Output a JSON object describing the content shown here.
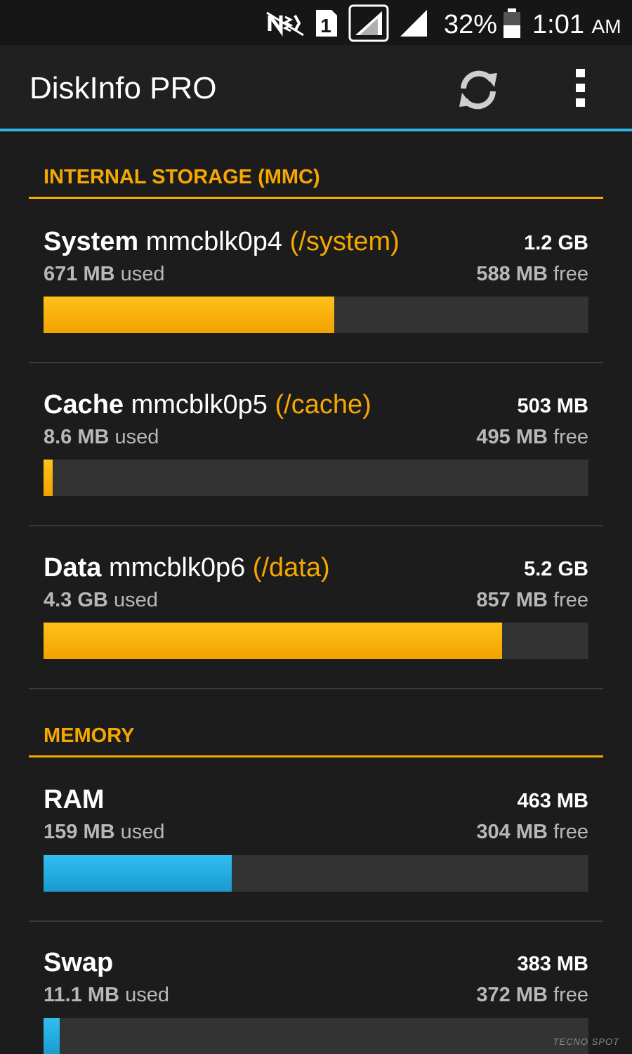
{
  "status_bar": {
    "battery_percent": "32%",
    "time": "1:01",
    "ampm": "AM",
    "sim_slot": "1",
    "icons": [
      "nfc-muted-icon",
      "sim-1-icon",
      "signal-boxed-icon",
      "signal-icon",
      "battery-icon"
    ]
  },
  "app_bar": {
    "title": "DiskInfo PRO",
    "refresh_icon": "refresh-icon",
    "menu_icon": "overflow-menu-icon"
  },
  "colors": {
    "accent": "#f5a800",
    "memory_bar": "#33b5e5",
    "action_bar_line": "#33b5e5",
    "background": "#1c1c1c"
  },
  "sections": [
    {
      "title": "INTERNAL STORAGE (MMC)",
      "items": [
        {
          "name": "System",
          "device": "mmcblk0p4",
          "mount": "(/system)",
          "total": "1.2 GB",
          "used_value": "671 MB",
          "used_label": "used",
          "free_value": "588 MB",
          "free_label": "free",
          "fill": 0.534,
          "color": "orange"
        },
        {
          "name": "Cache",
          "device": "mmcblk0p5",
          "mount": "(/cache)",
          "total": "503 MB",
          "used_value": "8.6 MB",
          "used_label": "used",
          "free_value": "495 MB",
          "free_label": "free",
          "fill": 0.017,
          "color": "orange"
        },
        {
          "name": "Data",
          "device": "mmcblk0p6",
          "mount": "(/data)",
          "total": "5.2 GB",
          "used_value": "4.3 GB",
          "used_label": "used",
          "free_value": "857 MB",
          "free_label": "free",
          "fill": 0.841,
          "color": "orange"
        }
      ]
    },
    {
      "title": "MEMORY",
      "items": [
        {
          "name": "RAM",
          "device": "",
          "mount": "",
          "total": "463 MB",
          "used_value": "159 MB",
          "used_label": "used",
          "free_value": "304 MB",
          "free_label": "free",
          "fill": 0.345,
          "color": "blue"
        },
        {
          "name": "Swap",
          "device": "",
          "mount": "",
          "total": "383 MB",
          "used_value": "11.1 MB",
          "used_label": "used",
          "free_value": "372 MB",
          "free_label": "free",
          "fill": 0.029,
          "color": "blue"
        }
      ]
    }
  ],
  "watermark": "TECNO SPOT"
}
